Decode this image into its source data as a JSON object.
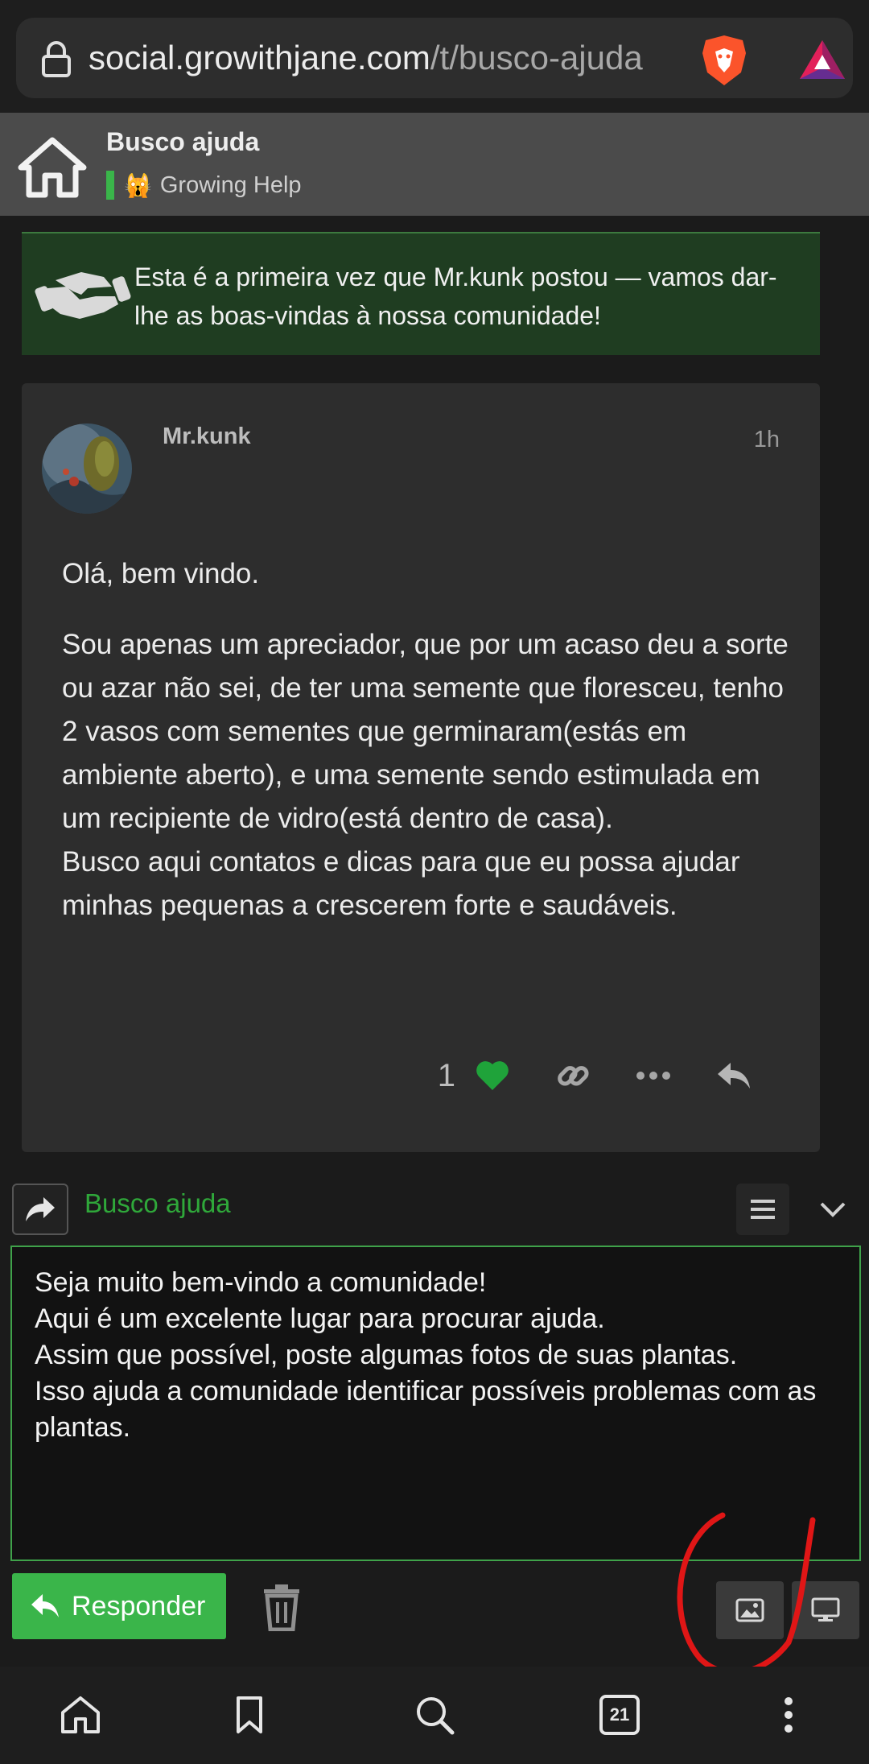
{
  "browser": {
    "url_main": "social.growithjane.com",
    "url_path": "/t/busco-ajuda",
    "tab_count": "21"
  },
  "topic": {
    "title": "Busco ajuda",
    "category": "Growing Help",
    "category_color": "#3ab54a"
  },
  "notice": {
    "text": "Esta é a primeira vez que Mr.kunk postou — vamos dar-lhe as boas-vindas à nossa comunidade!"
  },
  "post": {
    "username": "Mr.kunk",
    "time": "1h",
    "paragraphs": [
      "Olá, bem vindo.",
      "Sou apenas um apreciador, que por um acaso deu a sorte ou azar não sei, de ter uma semente que floresceu, tenho 2 vasos com sementes que germinaram(estás em ambiente aberto), e uma semente sendo estimulada em um recipiente de vidro(está dentro de casa).\nBusco aqui contatos e dicas para que eu possa ajudar minhas pequenas a crescerem forte e saudáveis."
    ],
    "like_count": "1",
    "like_color": "#1fa33a",
    "icons": [
      "heart-icon",
      "link-icon",
      "more-icon",
      "reply-icon"
    ]
  },
  "composer": {
    "reply_to": "Busco ajuda",
    "text": "Seja muito bem-vindo a comunidade!\nAqui é um excelente lugar para procurar ajuda.\nAssim que possível, poste algumas fotos de suas plantas.\nIsso ajuda a comunidade identificar possíveis problemas com as plantas.",
    "submit_label": "Responder",
    "accent": "#3ab54a"
  },
  "bottom_nav": [
    "home-icon",
    "bookmark-icon",
    "search-icon",
    "tabs-icon",
    "more-vert-icon"
  ]
}
